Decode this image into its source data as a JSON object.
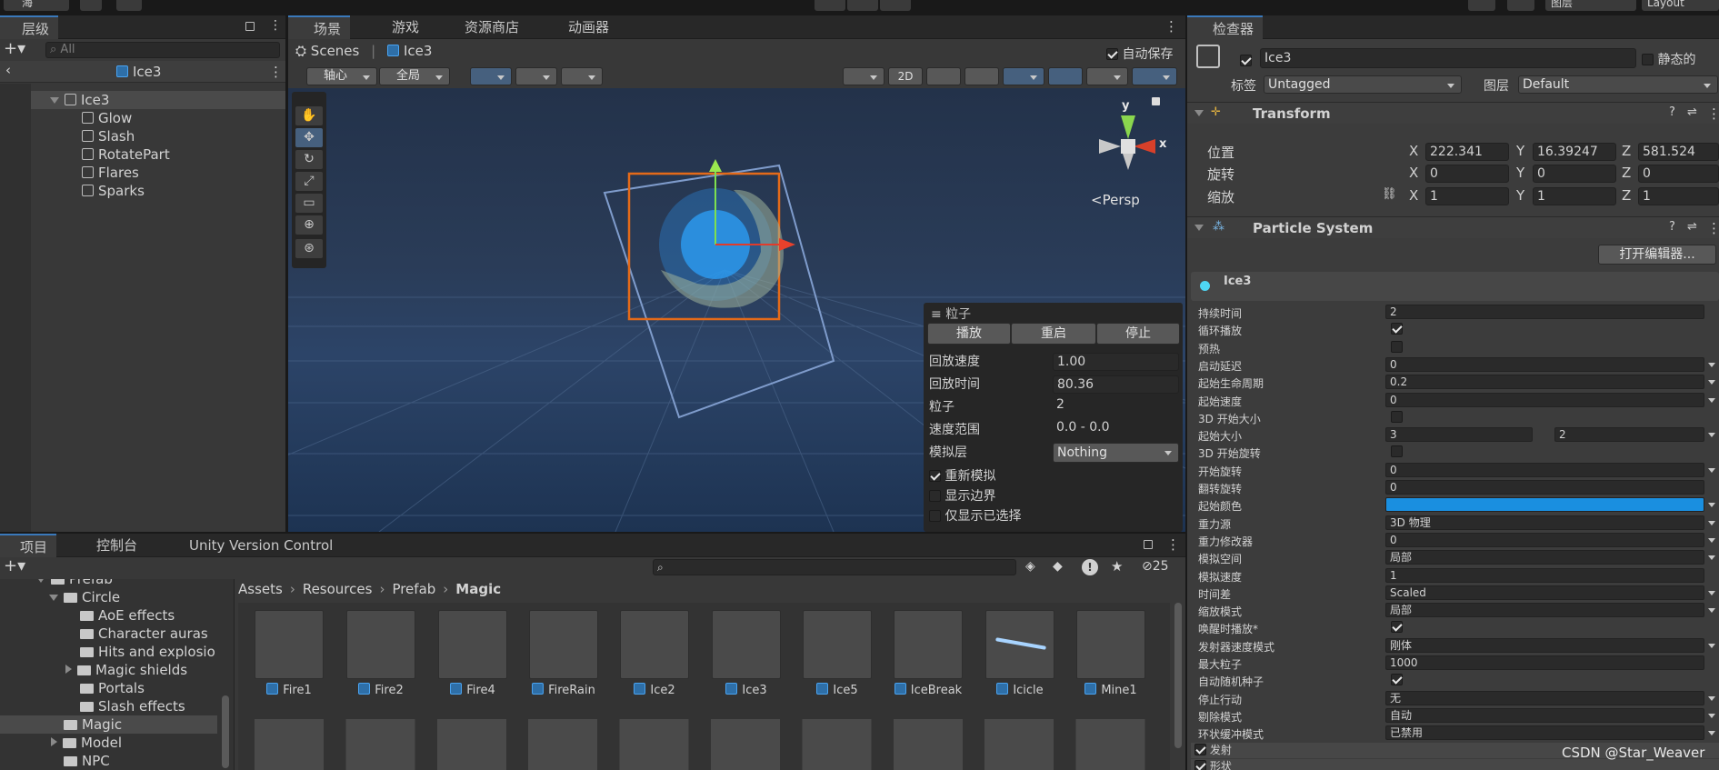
{
  "topbar": {
    "account": "海",
    "layers": "图层",
    "layout": "Layout"
  },
  "hierarchy": {
    "tab": "层级",
    "search_placeholder": "All",
    "scene": "Ice3",
    "items": [
      "Ice3",
      "Glow",
      "Slash",
      "RotatePart",
      "Flares",
      "Sparks"
    ]
  },
  "scene_view": {
    "tabs": [
      "场景",
      "游戏",
      "资源商店",
      "动画器"
    ],
    "breadcrumb_root": "Scenes",
    "breadcrumb_item": "Ice3",
    "autosave": "自动保存",
    "pivot": "轴心",
    "global": "全局",
    "mode_2d": "2D",
    "persp": "Persp",
    "gizmo_y": "y",
    "gizmo_x": "x"
  },
  "particle_overlay": {
    "title": "粒子",
    "play": "播放",
    "restart": "重启",
    "stop": "停止",
    "rows": [
      {
        "label": "回放速度",
        "value": "1.00"
      },
      {
        "label": "回放时间",
        "value": "80.36"
      },
      {
        "label": "粒子",
        "value": "2"
      },
      {
        "label": "速度范围",
        "value": "0.0 - 0.0"
      },
      {
        "label": "模拟层",
        "value": "Nothing"
      }
    ],
    "checks": [
      {
        "label": "重新模拟",
        "on": true
      },
      {
        "label": "显示边界",
        "on": false
      },
      {
        "label": "仅显示已选择",
        "on": false
      }
    ]
  },
  "project": {
    "tabs": [
      "项目",
      "控制台",
      "Unity Version Control"
    ],
    "hidden_count": "25",
    "breadcrumb": [
      "Assets",
      "Resources",
      "Prefab",
      "Magic"
    ],
    "tree": [
      {
        "label": "Prefab",
        "indent": 0
      },
      {
        "label": "Circle",
        "indent": 1
      },
      {
        "label": "AoE effects",
        "indent": 2
      },
      {
        "label": "Character auras",
        "indent": 2
      },
      {
        "label": "Hits and explosio",
        "indent": 2
      },
      {
        "label": "Magic shields",
        "indent": 2
      },
      {
        "label": "Portals",
        "indent": 2
      },
      {
        "label": "Slash effects",
        "indent": 2
      },
      {
        "label": "Magic",
        "indent": 1
      },
      {
        "label": "Model",
        "indent": 1
      },
      {
        "label": "NPC",
        "indent": 1
      }
    ],
    "assets": [
      "Fire1",
      "Fire2",
      "Fire4",
      "FireRain",
      "Ice2",
      "Ice3",
      "Ice5",
      "IceBreak",
      "Icicle",
      "Mine1"
    ]
  },
  "inspector": {
    "tab": "检查器",
    "name": "Ice3",
    "static": "静态的",
    "tag_label": "标签",
    "tag_value": "Untagged",
    "layer_label": "图层",
    "layer_value": "Default",
    "transform": {
      "title": "Transform",
      "rows": [
        {
          "label": "位置",
          "x": "222.341",
          "y": "16.39247",
          "z": "581.524"
        },
        {
          "label": "旋转",
          "x": "0",
          "y": "0",
          "z": "0"
        },
        {
          "label": "缩放",
          "x": "1",
          "y": "1",
          "z": "1"
        }
      ]
    },
    "particle_system": {
      "title": "Particle System",
      "open_editor": "打开编辑器...",
      "module": "Ice3",
      "props": [
        {
          "label": "持续时间",
          "value": "2"
        },
        {
          "label": "循环播放",
          "check": true
        },
        {
          "label": "预热",
          "check": false
        },
        {
          "label": "启动延迟",
          "value": "0",
          "dd": true
        },
        {
          "label": "起始生命周期",
          "value": "0.2",
          "dd": true
        },
        {
          "label": "起始速度",
          "value": "0",
          "dd": true
        },
        {
          "label": "3D 开始大小",
          "check": false
        },
        {
          "label": "起始大小",
          "value": "3",
          "value2": "2",
          "dd": true
        },
        {
          "label": "3D 开始旋转",
          "check": false
        },
        {
          "label": "开始旋转",
          "value": "0",
          "dd": true
        },
        {
          "label": "翻转旋转",
          "value": "0"
        },
        {
          "label": "起始颜色",
          "color": "#1a8fe0",
          "dd": true
        },
        {
          "label": "重力源",
          "value": "3D 物理",
          "dd": true
        },
        {
          "label": "重力修改器",
          "value": "0",
          "dd": true
        },
        {
          "label": "模拟空间",
          "value": "局部",
          "dd": true
        },
        {
          "label": "模拟速度",
          "value": "1"
        },
        {
          "label": "时间差",
          "value": "Scaled",
          "dd": true
        },
        {
          "label": "缩放模式",
          "value": "局部",
          "dd": true
        },
        {
          "label": "唤醒时播放*",
          "check": true
        },
        {
          "label": "发射器速度模式",
          "value": "刚体",
          "dd": true
        },
        {
          "label": "最大粒子",
          "value": "1000"
        },
        {
          "label": "自动随机种子",
          "check": true
        },
        {
          "label": "停止行动",
          "value": "无",
          "dd": true
        },
        {
          "label": "剔除模式",
          "value": "自动",
          "dd": true
        },
        {
          "label": "环状缓冲模式",
          "value": "已禁用",
          "dd": true
        }
      ],
      "modules": [
        "发射",
        "形状"
      ]
    }
  },
  "watermark": "CSDN @Star_Weaver"
}
